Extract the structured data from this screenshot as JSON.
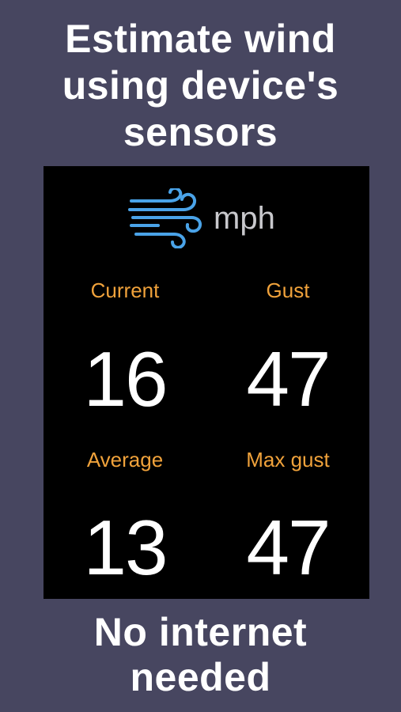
{
  "headline_top": [
    "Estimate wind",
    "using device's",
    "sensors"
  ],
  "headline_bottom": [
    "No internet",
    "needed"
  ],
  "panel": {
    "icon": "wind-icon",
    "unit": "mph",
    "stats": {
      "current": {
        "label": "Current",
        "value": "16"
      },
      "gust": {
        "label": "Gust",
        "value": "47"
      },
      "average": {
        "label": "Average",
        "value": "13"
      },
      "max_gust": {
        "label": "Max gust",
        "value": "47"
      }
    }
  },
  "colors": {
    "background": "#474660",
    "panel": "#000000",
    "label_accent": "#f0a23b",
    "icon": "#4aa3e8",
    "value_text": "#ffffff",
    "unit_text": "#c8c8cc"
  }
}
